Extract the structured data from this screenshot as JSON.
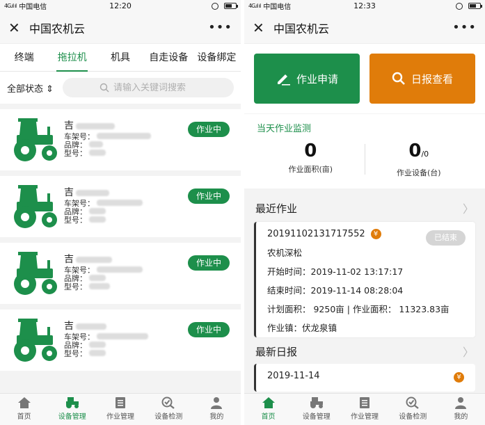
{
  "status": {
    "carrier": "中国电信",
    "left_time": "12:20",
    "right_time": "12:33",
    "signal": "4G.ıl ıl"
  },
  "app_title": "中国农机云",
  "left": {
    "tabs": [
      {
        "label": "终端"
      },
      {
        "label": "拖拉机"
      },
      {
        "label": "机具"
      },
      {
        "label": "自走设备"
      },
      {
        "label": "设备绑定"
      }
    ],
    "filter": {
      "state_label": "全部状态",
      "search_placeholder": "请输入关键词搜索"
    },
    "cards": [
      {
        "name": "吉",
        "frame_label": "车架号：",
        "plate_label": "品牌：",
        "model_label": "型号：",
        "badge": "作业中"
      },
      {
        "name": "吉",
        "frame_label": "车架号：",
        "plate_label": "品牌：",
        "model_label": "型号：",
        "badge": "作业中"
      },
      {
        "name": "吉",
        "frame_label": "车架号：",
        "plate_label": "品牌：",
        "model_label": "型号：",
        "badge": "作业中"
      },
      {
        "name": "吉",
        "frame_label": "车架号：",
        "plate_label": "品牌：",
        "model_label": "型号：",
        "badge": "作业中"
      }
    ]
  },
  "right": {
    "actions": {
      "apply": "作业申请",
      "report": "日报查看"
    },
    "monitor": {
      "title": "当天作业监测",
      "area_value": "0",
      "area_label": "作业面积(亩)",
      "device_value": "0",
      "device_total": "/0",
      "device_label": "作业设备(台)"
    },
    "recent": {
      "title": "最近作业",
      "id": "20191102131717552",
      "status": "已结束",
      "type": "农机深松",
      "start": "开始时间：2019-11-02 13:17:17",
      "end": "结束时间：2019-11-14 08:28:04",
      "area": "计划面积：  9250亩 | 作业面积：  11323.83亩",
      "town": "作业镇：伏龙泉镇"
    },
    "daily": {
      "title": "最新日报",
      "date": "2019-11-14"
    }
  },
  "nav": [
    {
      "label": "首页"
    },
    {
      "label": "设备管理"
    },
    {
      "label": "作业管理"
    },
    {
      "label": "设备检测"
    },
    {
      "label": "我的"
    }
  ],
  "colors": {
    "green": "#1d8f4b",
    "orange": "#e07c0a"
  }
}
